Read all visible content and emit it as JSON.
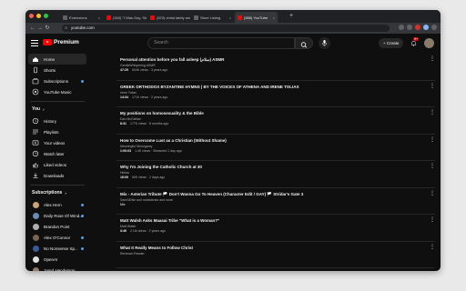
{
  "browser": {
    "tabs": [
      {
        "title": "Extensions",
        "fav": "#5f6368",
        "active": false
      },
      {
        "title": "(340) \"I Was Gay, She Was T...",
        "fav": "#ff0000",
        "active": false
      },
      {
        "title": "(523) christ lately and gay rite...",
        "fav": "#ff0000",
        "active": false
      },
      {
        "title": "Store Listing",
        "fav": "#5f6368",
        "active": false
      },
      {
        "title": "(586) YouTube",
        "fav": "#ff0000",
        "active": true
      }
    ],
    "new_tab": "+",
    "url": "youtube.com"
  },
  "header": {
    "logo_text": "Premium",
    "search_placeholder": "Search",
    "create_label": "+ Create",
    "notif_count": "9+"
  },
  "sidebar": {
    "primary": [
      {
        "label": "Home",
        "icon": "home-icon",
        "active": true
      },
      {
        "label": "Shorts",
        "icon": "shorts-icon",
        "active": false
      },
      {
        "label": "Subscriptions",
        "icon": "subscriptions-icon",
        "active": false,
        "live": true
      },
      {
        "label": "YouTube Music",
        "icon": "youtube-music-icon",
        "active": false
      }
    ],
    "you_heading": "You",
    "you": [
      {
        "label": "History",
        "icon": "history-icon"
      },
      {
        "label": "Playlists",
        "icon": "playlists-icon"
      },
      {
        "label": "Your videos",
        "icon": "your-videos-icon"
      },
      {
        "label": "Watch later",
        "icon": "watch-later-icon"
      },
      {
        "label": "Liked videos",
        "icon": "liked-videos-icon"
      },
      {
        "label": "Downloads",
        "icon": "downloads-icon"
      }
    ],
    "subs_heading": "Subscriptions",
    "subscriptions": [
      {
        "label": "Alex Hern",
        "color": "#c9a27a",
        "live": true
      },
      {
        "label": "Daily Rose Of Wind...",
        "color": "#6d8bb0",
        "live": true
      },
      {
        "label": "Brandon Point",
        "color": "#b0b0b0",
        "live": false
      },
      {
        "label": "Alex O'Connor",
        "color": "#7a6552",
        "live": true
      },
      {
        "label": "No Nonsense Sp...",
        "color": "#3b5998",
        "live": true
      },
      {
        "label": "OpenAI",
        "color": "#e0e0e0",
        "live": false
      },
      {
        "label": "Jared Henderson",
        "color": "#8f7c6b",
        "live": false
      }
    ]
  },
  "videos": [
    {
      "title": "Personal attention before you fall asleep (سلام) ASMR",
      "channel": "GentleWhispering ASMR",
      "duration": "47:29",
      "views": "604K views",
      "age": "3 years ago"
    },
    {
      "title": "GREEK ORTHODOX BYZANTINE HYMNS | BY THE VOICES OF ATHENA AND IRENE TOLIAS",
      "channel": "Irene Tolias",
      "duration": "14:34",
      "views": "171K views",
      "age": "2 years ago"
    },
    {
      "title": "My positions on homosexuality & the Bible",
      "channel": "Dan McClellan",
      "duration": "8:31",
      "views": "177K views",
      "age": "8 months ago"
    },
    {
      "title": "How to Overcome Lust as a Christian (Without Shame)",
      "channel": "Meaningful Monogamy",
      "duration": "1:00:03",
      "views": "1.4K views",
      "age": "Streamed 1 day ago"
    },
    {
      "title": "Why I'm Joining the Catholic Church at 30",
      "channel": "Hintao",
      "duration": "16:00",
      "views": "60K views",
      "age": "2 days ago"
    },
    {
      "title": "Mix - Asterian Tribute 🏳️ Don't Wanna Go To Heaven (Character Edit / GAY) 🏳️ Stridar's Gate 3",
      "channel": "SamS4Nte and notAsteriax and more",
      "duration": "",
      "views": "",
      "age": "",
      "extra": "Mix"
    },
    {
      "title": "Matt Walsh Asks Maasai Tribe \"What is a Woman?\"",
      "channel": "Matt Walsh",
      "duration": "3:49",
      "views": "2.1M views",
      "age": "2 years ago"
    },
    {
      "title": "What It Really Means to Follow Christ",
      "channel": "Remnant Reader",
      "duration": "",
      "views": "",
      "age": ""
    }
  ]
}
